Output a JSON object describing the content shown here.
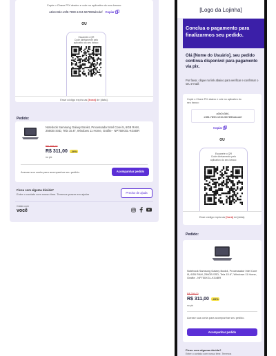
{
  "left": {
    "pix_instruction": "Copie o Chave PIX abaixo e cole no aplicativo do seu banco:",
    "pix_code": "a1b2c3d4-e5f6-7890-1234-567890abcdef",
    "copy_label": "Copiar",
    "ou": "OU",
    "phone_text_1": "Escaneie o QR",
    "phone_text_2": "Code diretamente pelo",
    "phone_text_3": "aplicativo do seu banco:",
    "expires_prefix": "Esse código expira as",
    "expires_time": "[hora]",
    "expires_suffix": "de [data].",
    "order_heading": "Pedido:",
    "product_name": "Notebook Samsung Galaxy Book4, Processador Intel Core i5, 6GB RAM, 256GB SSD, Tela 15.6\", Windows 11 Home, Grafite - NP750XGL-KG4BR",
    "old_price": "R$ 399,00",
    "price": "R$ 311,00",
    "discount": "-20%",
    "payment_method": "no pix",
    "account_text": "Acesse sua conta para acompanhar seu pedido.",
    "track_button": "Acompanhar pedido",
    "help_title": "Ficou com alguma dúvida?",
    "help_text": "Entre o contato com nosso time. Teremos prazer em ajudar",
    "help_button": "Preciso de ajuda",
    "footer_small": "Criado com",
    "footer_brand": "você"
  },
  "right": {
    "logo": "[Logo da Lojinha]",
    "hero_title": "Conclua o pagamento para finalizarmos seu pedido.",
    "greeting": "Olá [Nome do Usuário], seu pedido continua disponível para pagamento via pix.",
    "instruction": "Por favor, clique no link abaixo para verificar e confirmar o seu e-mail:",
    "pix_instruction": "Copie o Chave PIX abaixo e cole no aplicativo do seu banco:",
    "pix_code_1": "a1b2c3d4-",
    "pix_code_2": "e5f6-7890-1234-567890abcdef",
    "copy_label": "Copiar",
    "ou": "OU",
    "phone_text_1": "Escaneie o QR",
    "phone_text_2": "Code diretamente pelo",
    "phone_text_3": "aplicativo do seu banco:",
    "expires_prefix": "Esse código expira as",
    "expires_time": "[hora]",
    "expires_suffix": "de [data].",
    "order_heading": "Pedido:",
    "product_name": "Notebook Samsung Galaxy Book4, Processador Intel Core i5, 6GB RAM, 256GB SSD, Tela 15.6\", Windows 11 Home, Grafite - NP750XGL-KG4BR",
    "old_price": "R$ 399,00",
    "price": "R$ 311,00",
    "discount": "-20%",
    "payment_method": "no pix",
    "account_text": "Acesse sua conta para acompanhar seu pedido.",
    "track_button": "Acompanhar pedido",
    "help_title": "Ficou com alguma dúvida?",
    "help_text": "Entre o contato com nosso time. Teremos"
  },
  "colors": {
    "accent": "#5b2fd6",
    "hero": "#3b1fa8",
    "panel": "#eceaf7",
    "discount": "#f7e14a",
    "old_price": "#d0383d"
  },
  "icons": [
    "copy-icon",
    "instagram-icon",
    "facebook-icon",
    "youtube-icon",
    "laptop-image",
    "qr-code"
  ]
}
